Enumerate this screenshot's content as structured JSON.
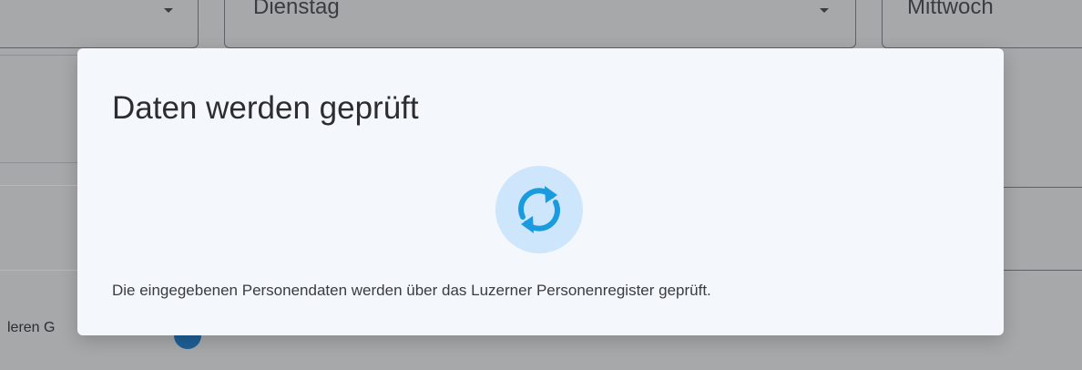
{
  "background_form": {
    "day_select_tuesday": "Dienstag",
    "day_select_wednesday": "Mittwoch",
    "partial_label": "leren G"
  },
  "dialog": {
    "title": "Daten werden geprüft",
    "message": "Die eingegebenen Personendaten werden über das Luzerner Personenregister geprüft.",
    "spinner_icon": "sync-icon"
  },
  "colors": {
    "overlay": "#a6a8aa",
    "dialog_bg": "#f4f7fc",
    "spinner_bg": "#cde6fb",
    "spinner_fg": "#1a9be0"
  }
}
